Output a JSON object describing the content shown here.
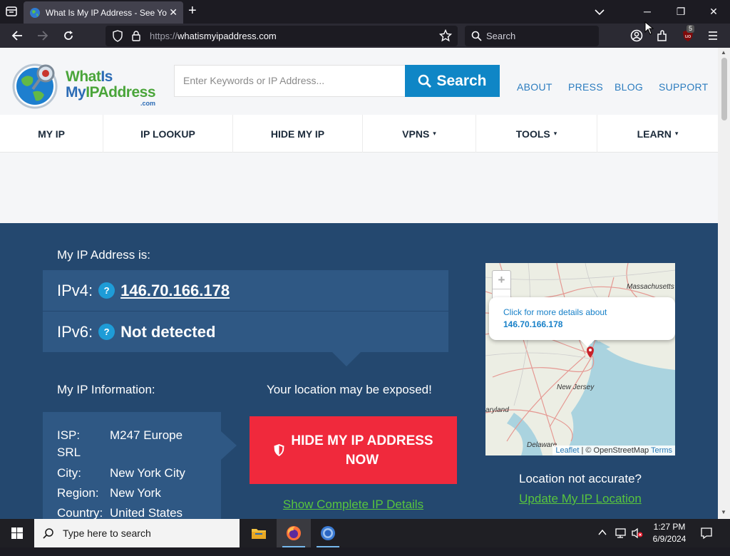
{
  "browser": {
    "tab_title": "What Is My IP Address - See You",
    "url_proto": "https://",
    "url_host": "whatismyipaddress.com",
    "search_placeholder": "Search",
    "extension_badge": "5"
  },
  "site": {
    "logo": {
      "line1a": "What",
      "line1b": "Is",
      "line2a": "My",
      "line2b": "IPAddress",
      "line3": ".com"
    },
    "search_placeholder": "Enter Keywords or IP Address...",
    "search_button": "Search",
    "top_links": [
      "ABOUT",
      "PRESS",
      "BLOG",
      "SUPPORT"
    ],
    "nav": [
      {
        "label": "MY IP",
        "dropdown": false
      },
      {
        "label": "IP LOOKUP",
        "dropdown": false
      },
      {
        "label": "HIDE MY IP",
        "dropdown": false
      },
      {
        "label": "VPNS",
        "dropdown": true
      },
      {
        "label": "TOOLS",
        "dropdown": true
      },
      {
        "label": "LEARN",
        "dropdown": true
      }
    ],
    "caret": "▾"
  },
  "hero": {
    "my_ip_label": "My IP Address is:",
    "ipv4_label": "IPv4:",
    "ipv4_value": "146.70.166.178",
    "ipv6_label": "IPv6:",
    "ipv6_value": "Not detected",
    "help_glyph": "?",
    "info_label": "My IP Information:",
    "exposed_text": "Your location may be exposed!",
    "info": {
      "isp_key": "ISP:",
      "isp_val": "M247 Europe",
      "isp_val2": "SRL",
      "city_key": "City:",
      "city_val": "New York City",
      "region_key": "Region:",
      "region_val": "New York",
      "country_key": "Country:",
      "country_val": "United States"
    },
    "hide_button_line1": "HIDE MY IP ADDRESS",
    "hide_button_line2": "NOW",
    "show_details": "Show Complete IP Details",
    "map": {
      "zoom_in": "+",
      "zoom_out": "−",
      "popup_line1": "Click for more details about",
      "popup_line2": "146.70.166.178",
      "labels": [
        "Massachusetts",
        "New Jersey",
        "aryland",
        "Delaware"
      ],
      "attr_leaflet": "Leaflet",
      "attr_sep": " | © OpenStreetMap ",
      "attr_terms": "Terms"
    },
    "loc_question": "Location not accurate?",
    "loc_link": "Update My IP Location"
  },
  "taskbar": {
    "search_placeholder": "Type here to search",
    "time": "1:27 PM",
    "date": "6/9/2024"
  },
  "colors": {
    "hero_bg": "#24486f",
    "box_bg": "#2f5884",
    "accent_blue": "#0f86c6",
    "hide_red": "#f0293c",
    "link_green": "#58c53d"
  }
}
